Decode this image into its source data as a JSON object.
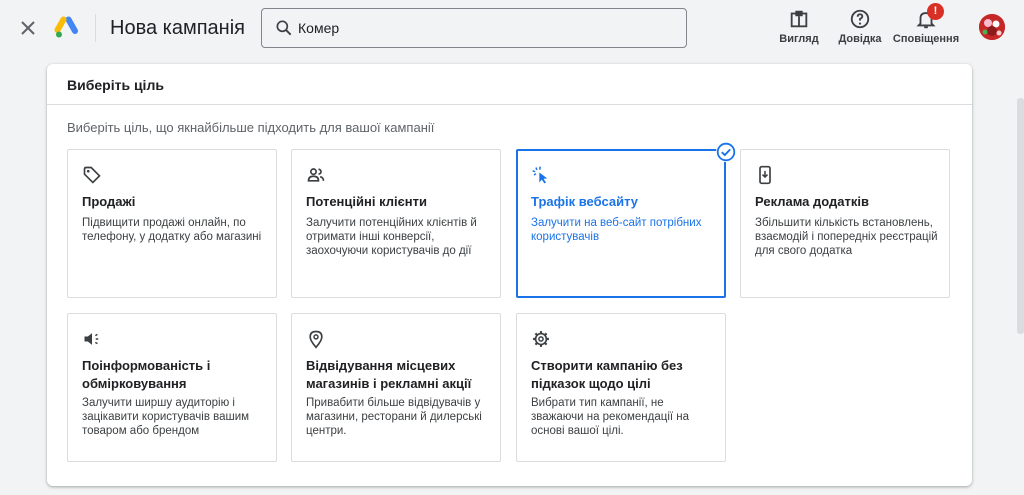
{
  "header": {
    "title": "Нова кампанія",
    "search": {
      "value": "Комер",
      "placeholder": ""
    },
    "tools": {
      "view_label": "Вигляд",
      "help_label": "Довідка",
      "notifications_label": "Сповіщення",
      "notifications_badge": "!"
    },
    "icons": [
      "close-icon",
      "google-ads-logo",
      "search-icon",
      "view-icon",
      "help-icon",
      "bell-icon",
      "avatar"
    ]
  },
  "main": {
    "heading": "Виберіть ціль",
    "subtitle": "Виберіть ціль, що якнайбільше підходить для вашої кампанії",
    "goals": [
      {
        "icon": "tag-icon",
        "title": "Продажі",
        "description": "Підвищити продажі онлайн, по телефону, у додатку або магазині",
        "selected": false
      },
      {
        "icon": "people-icon",
        "title": "Потенційні клієнти",
        "description": "Залучити потенційних клієнтів й отримати інші конверсії, заохочуючи користувачів до дії",
        "selected": false
      },
      {
        "icon": "cursor-click-icon",
        "title": "Трафік вебсайту",
        "description": "Залучити на веб-сайт потрібних користувачів",
        "selected": true
      },
      {
        "icon": "phone-download-icon",
        "title": "Реклама додатків",
        "description": "Збільшити кількість встановлень, взаємодій і попередніх реєстрацій для свого додатка",
        "selected": false
      },
      {
        "icon": "megaphone-icon",
        "title": "Поінформованість і обмірковування",
        "description": "Залучити ширшу аудиторію і зацікавити користувачів вашим товаром або брендом",
        "selected": false
      },
      {
        "icon": "location-pin-icon",
        "title": "Відвідування місцевих магазинів і рекламні акції",
        "description": "Привабити більше відвідувачів у магазини, ресторани й дилерські центри.",
        "selected": false
      },
      {
        "icon": "gear-icon",
        "title": "Створити кампанію без підказок щодо цілі",
        "description": "Вибрати тип кампанії, не зважаючи на рекомендації на основі вашої цілі.",
        "selected": false
      }
    ]
  },
  "colors": {
    "accent": "#1a73e8",
    "background": "#f1f3f4",
    "card": "#ffffff",
    "border": "#dadce0",
    "badge": "#d93025"
  }
}
